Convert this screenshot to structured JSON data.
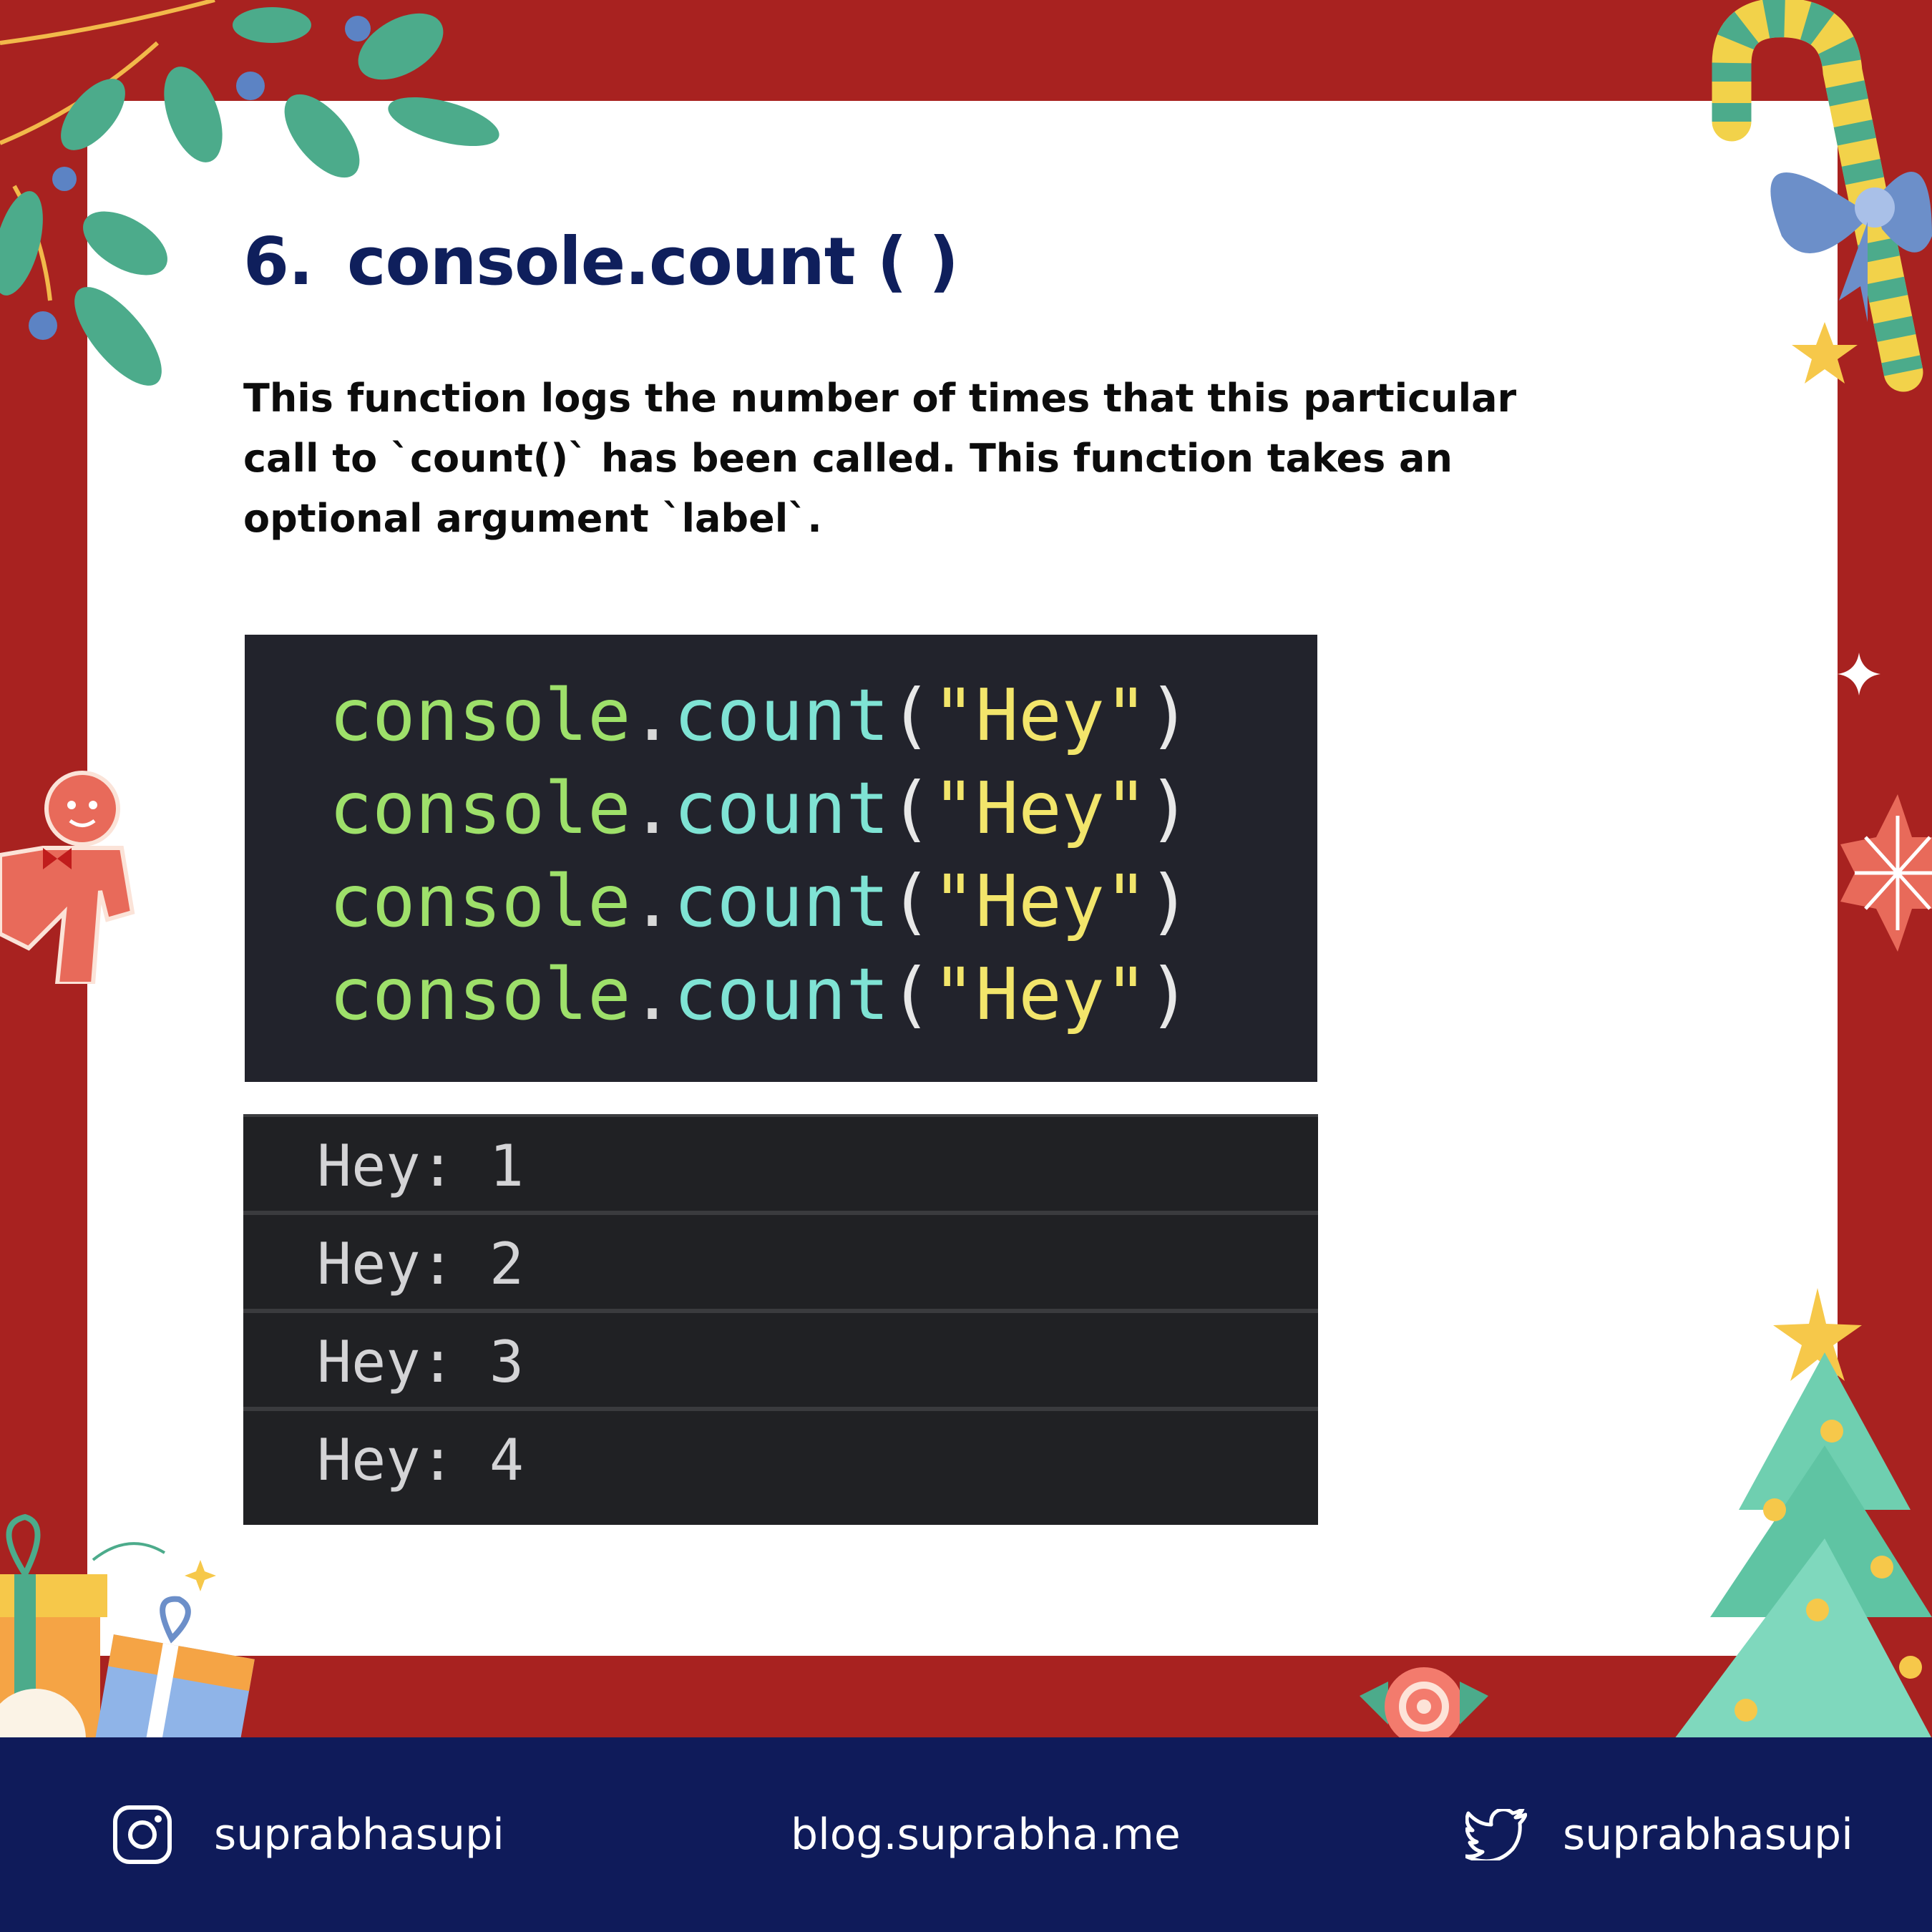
{
  "slide": {
    "number": "6.",
    "title": "console.count ( )",
    "description": "This function logs the number of times that this particular call to `count()` has been called. This function takes an optional argument `label`."
  },
  "code": {
    "lines": [
      {
        "obj": "console",
        "dot": ".",
        "fn": "count",
        "open": "(",
        "str": "\"Hey\"",
        "close": ")"
      },
      {
        "obj": "console",
        "dot": ".",
        "fn": "count",
        "open": "(",
        "str": "\"Hey\"",
        "close": ")"
      },
      {
        "obj": "console",
        "dot": ".",
        "fn": "count",
        "open": "(",
        "str": "\"Hey\"",
        "close": ")"
      },
      {
        "obj": "console",
        "dot": ".",
        "fn": "count",
        "open": "(",
        "str": "\"Hey\"",
        "close": ")"
      }
    ]
  },
  "console_output": {
    "rows": [
      "Hey: 1",
      "Hey: 2",
      "Hey: 3",
      "Hey: 4"
    ]
  },
  "footer": {
    "instagram_handle": "suprabhasupi",
    "blog_url": "blog.suprabha.me",
    "twitter_handle": "suprabhasupi"
  },
  "colors": {
    "frame_red": "#a82220",
    "navy": "#0f1b5a",
    "code_bg": "#22232c",
    "console_bg": "#202124"
  },
  "icons": [
    "instagram-icon",
    "twitter-icon"
  ]
}
